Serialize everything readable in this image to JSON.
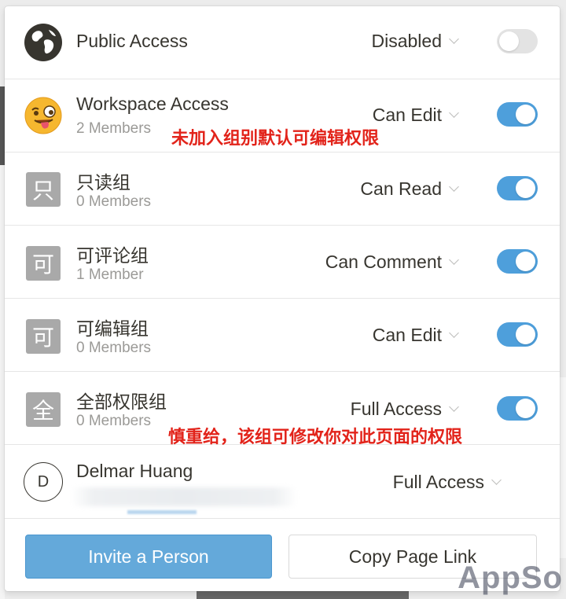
{
  "rows": [
    {
      "name": "Public Access",
      "permission": "Disabled",
      "toggle": false,
      "icon": "globe-icon"
    },
    {
      "name": "Workspace Access",
      "members": "2 Members",
      "permission": "Can Edit",
      "toggle": true,
      "icon": "tongue-face-emoji"
    },
    {
      "name": "只读组",
      "members": "0 Members",
      "permission": "Can Read",
      "toggle": true,
      "icon_glyph": "只"
    },
    {
      "name": "可评论组",
      "members": "1 Member",
      "permission": "Can Comment",
      "toggle": true,
      "icon_glyph": "可"
    },
    {
      "name": "可编辑组",
      "members": "0 Members",
      "permission": "Can Edit",
      "toggle": true,
      "icon_glyph": "可"
    },
    {
      "name": "全部权限组",
      "members": "0 Members",
      "permission": "Full Access",
      "toggle": true,
      "icon_glyph": "全"
    },
    {
      "name": "Delmar Huang",
      "permission": "Full Access",
      "avatar_initial": "D"
    }
  ],
  "annotations": {
    "workspace_note": "未加入组别默认可编辑权限",
    "full_access_note": "慎重给，该组可修改你对此页面的权限"
  },
  "footer": {
    "invite_label": "Invite a Person",
    "copy_link_label": "Copy Page Link"
  },
  "watermark": "AppSo",
  "colors": {
    "toggle_on": "#4e9fdb",
    "toggle_off": "#e3e3e3",
    "primary_button": "#64a9da",
    "annotation_red": "#e2231a",
    "group_icon_gray": "#a9a9a9"
  }
}
